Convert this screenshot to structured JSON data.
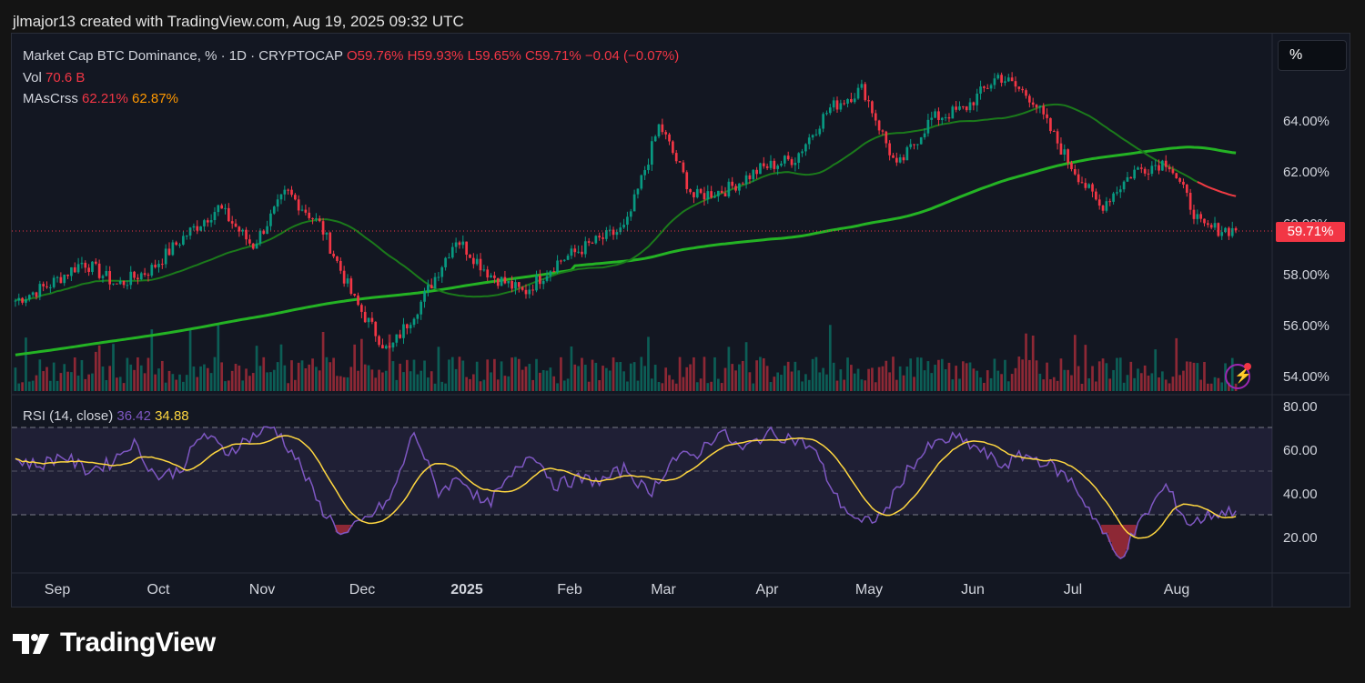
{
  "header": {
    "author_line": "jlmajor13 created with TradingView.com, Aug 19, 2025 09:32 UTC"
  },
  "legend": {
    "symbol": "Market Cap BTC Dominance, % · 1D · CRYPTOCAP",
    "open": "O59.76%",
    "high": "H59.93%",
    "low": "L59.65%",
    "close": "C59.71%",
    "change": "−0.04 (−0.07%)",
    "vol_label": "Vol",
    "vol_value": "70.6 B",
    "ma_label": "MAsCrss",
    "ma1": "62.21%",
    "ma2": "62.87%",
    "rsi_label": "RSI (14, close)",
    "rsi_value": "36.42",
    "rsi_ma": "34.88"
  },
  "price_axis": {
    "ticks": [
      "64.00%",
      "62.00%",
      "58.00%",
      "56.00%",
      "54.00%"
    ],
    "obscured_tick": "60.00%",
    "last_price": "59.71%"
  },
  "rsi_axis": {
    "ticks": [
      "80.00",
      "60.00",
      "40.00",
      "20.00"
    ]
  },
  "x_axis": {
    "labels": [
      "Sep",
      "Oct",
      "Nov",
      "Dec",
      "2025",
      "Feb",
      "Mar",
      "Apr",
      "May",
      "Jun",
      "Jul",
      "Aug"
    ]
  },
  "scale_button": "%",
  "brand": "TradingView",
  "colors": {
    "up": "#089981",
    "down": "#f23645",
    "ma_fast": "#1b7a1b",
    "ma_slow": "#24b324",
    "rsi": "#7e57c2",
    "rsi_ma": "#ffd740",
    "bg": "#131722"
  },
  "chart_data": {
    "type": "candlestick",
    "symbol": "Market Cap BTC Dominance, %",
    "x_range": [
      "Sep",
      "Aug"
    ],
    "price_ylim": [
      53.5,
      66.5
    ],
    "price_path": [
      {
        "x": "Aug 2024",
        "y": 57.0
      },
      {
        "x": "Sep",
        "y": 57.6
      },
      {
        "x": "Sep",
        "y": 58.5
      },
      {
        "x": "Oct",
        "y": 57.6
      },
      {
        "x": "Oct",
        "y": 58.2
      },
      {
        "x": "Oct",
        "y": 59.5
      },
      {
        "x": "Nov",
        "y": 60.6
      },
      {
        "x": "Nov",
        "y": 59.1
      },
      {
        "x": "Nov",
        "y": 61.2
      },
      {
        "x": "Nov",
        "y": 59.9
      },
      {
        "x": "Dec",
        "y": 57.0
      },
      {
        "x": "Dec",
        "y": 55.0
      },
      {
        "x": "Dec",
        "y": 57.0
      },
      {
        "x": "Dec",
        "y": 59.4
      },
      {
        "x": "Dec",
        "y": 58.0
      },
      {
        "x": "2025",
        "y": 57.3
      },
      {
        "x": "2025",
        "y": 58.5
      },
      {
        "x": "Jan",
        "y": 59.2
      },
      {
        "x": "Jan",
        "y": 59.8
      },
      {
        "x": "Feb",
        "y": 63.8
      },
      {
        "x": "Feb",
        "y": 61.0
      },
      {
        "x": "Mar",
        "y": 61.3
      },
      {
        "x": "Mar",
        "y": 62.1
      },
      {
        "x": "Apr",
        "y": 62.5
      },
      {
        "x": "Apr",
        "y": 64.4
      },
      {
        "x": "May",
        "y": 65.2
      },
      {
        "x": "May",
        "y": 62.1
      },
      {
        "x": "May",
        "y": 64.0
      },
      {
        "x": "Jun",
        "y": 64.4
      },
      {
        "x": "Jun",
        "y": 65.7
      },
      {
        "x": "Jul",
        "y": 64.8
      },
      {
        "x": "Jul",
        "y": 62.5
      },
      {
        "x": "Jul",
        "y": 60.6
      },
      {
        "x": "Jul",
        "y": 62.0
      },
      {
        "x": "Aug",
        "y": 62.4
      },
      {
        "x": "Aug",
        "y": 59.8
      },
      {
        "x": "Aug",
        "y": 59.71
      }
    ],
    "rsi_ylim": [
      10,
      85
    ],
    "rsi_levels": [
      70,
      50,
      30
    ],
    "rsi_path": [
      60,
      57,
      62,
      55,
      58,
      68,
      52,
      55,
      72,
      63,
      70,
      75,
      60,
      38,
      25,
      33,
      42,
      73,
      45,
      52,
      38,
      50,
      64,
      48,
      51,
      50,
      56,
      44,
      60,
      62,
      73,
      64,
      72,
      70,
      65,
      42,
      30,
      35,
      55,
      66,
      70,
      65,
      57,
      62,
      58,
      50,
      33,
      14,
      32,
      48,
      30,
      35,
      36.42
    ],
    "ma_values": {
      "fast": 62.21,
      "slow": 62.87
    }
  }
}
